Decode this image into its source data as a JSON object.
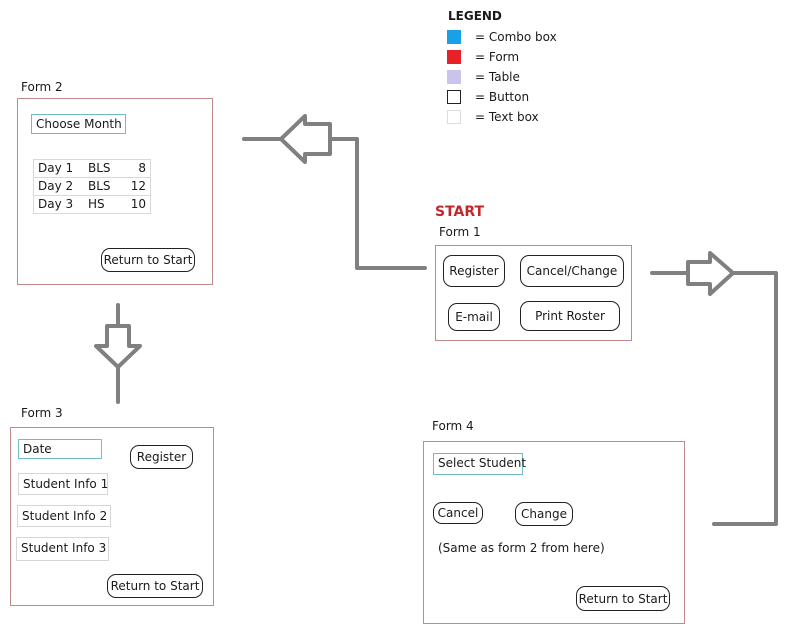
{
  "legend": {
    "title": "LEGEND",
    "items": [
      {
        "label": "= Combo box",
        "color": "#1aa0e6"
      },
      {
        "label": "= Form",
        "color": "#e8202a"
      },
      {
        "label": "= Table",
        "color": "#c8c4ec"
      },
      {
        "label": "= Button",
        "color": "#ffffff"
      },
      {
        "label": "= Text box",
        "color": "#ffffff"
      }
    ]
  },
  "start_label": "START",
  "form1": {
    "label": "Form 1",
    "buttons": [
      "Register",
      "Cancel/Change",
      "E-mail",
      "Print Roster"
    ]
  },
  "form2": {
    "label": "Form 2",
    "combo": "Choose Month",
    "table": [
      [
        "Day 1",
        "BLS",
        "8"
      ],
      [
        "Day 2",
        "BLS",
        "12"
      ],
      [
        "Day 3",
        "HS",
        "10"
      ]
    ],
    "return_button": "Return to Start"
  },
  "form3": {
    "label": "Form 3",
    "combo": "Date",
    "textboxes": [
      "Student Info 1",
      "Student Info 2",
      "Student Info 3"
    ],
    "register_button": "Register",
    "return_button": "Return to Start"
  },
  "form4": {
    "label": "Form 4",
    "combo": "Select Student",
    "cancel_button": "Cancel",
    "change_button": "Change",
    "note": "(Same as form 2 from here)",
    "return_button": "Return to Start"
  },
  "colors": {
    "form_border": "#c08a8a",
    "combo_border": "#6fbcc4",
    "arrow": "#808080",
    "start": "#c0282e"
  }
}
